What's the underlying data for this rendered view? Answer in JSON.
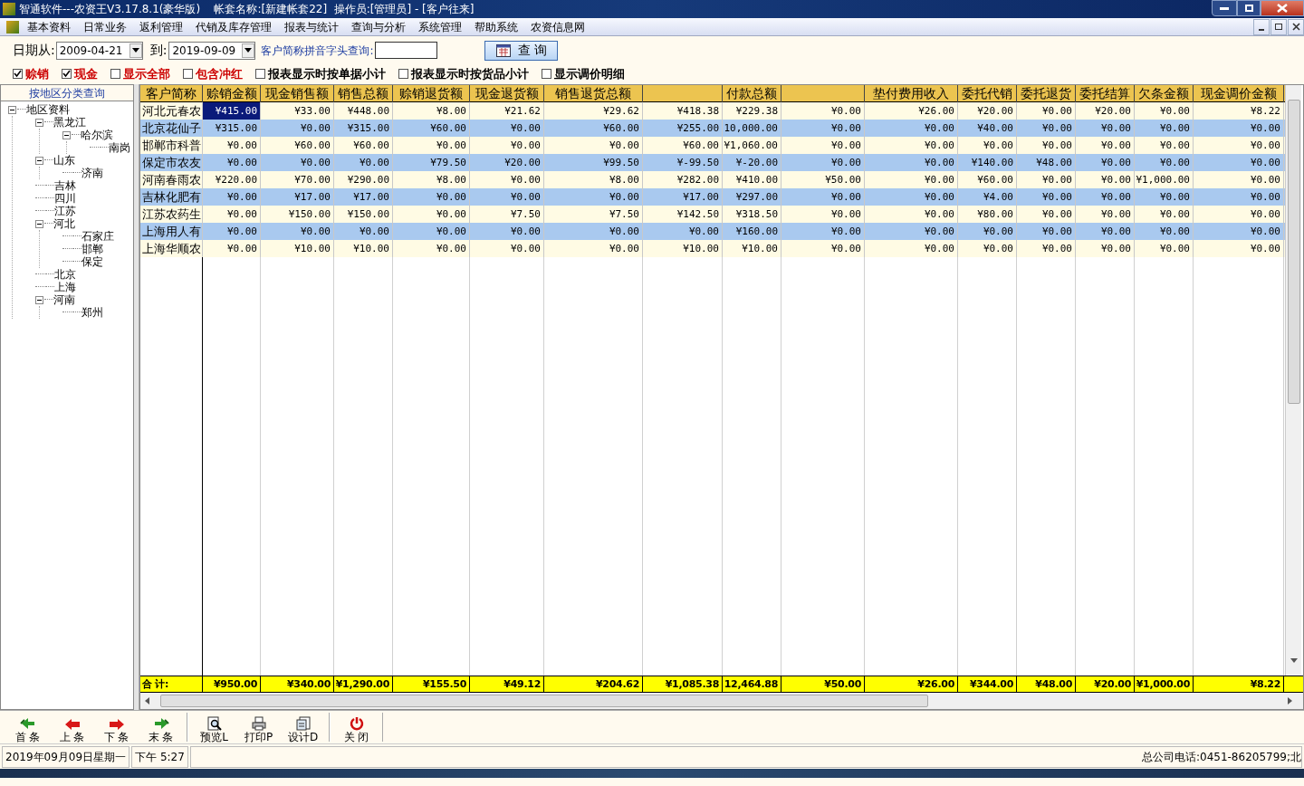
{
  "window": {
    "title": "智通软件---农资王V3.17.8.1(豪华版)    帐套名称:[新建帐套22]  操作员:[管理员] - [客户往来]"
  },
  "menu": [
    "基本资料",
    "日常业务",
    "返利管理",
    "代销及库存管理",
    "报表与统计",
    "查询与分析",
    "系统管理",
    "帮助系统",
    "农资信息网"
  ],
  "filters": {
    "date_from_label": "日期从:",
    "date_from": "2009-04-21",
    "date_to_label": "到:",
    "date_to": "2019-09-09",
    "pinyin_label": "客户简称拼音字头查询:",
    "query_button": "查 询"
  },
  "options": [
    {
      "label": "赊销",
      "checked": true,
      "color": "#cc0000"
    },
    {
      "label": "现金",
      "checked": true,
      "color": "#cc0000"
    },
    {
      "label": "显示全部",
      "checked": false,
      "color": "#cc0000"
    },
    {
      "label": "包含冲红",
      "checked": false,
      "color": "#cc0000"
    },
    {
      "label": "报表显示时按单据小计",
      "checked": false,
      "color": "#000000"
    },
    {
      "label": "报表显示时按货品小计",
      "checked": false,
      "color": "#000000"
    },
    {
      "label": "显示调价明细",
      "checked": false,
      "color": "#000000"
    }
  ],
  "sidebar": {
    "title": "按地区分类查询",
    "tree": [
      {
        "label": "地区资料",
        "expanded": true,
        "children": [
          {
            "label": "黑龙江",
            "expanded": true,
            "children": [
              {
                "label": "哈尔滨",
                "expanded": true,
                "children": [
                  {
                    "label": "南岗"
                  }
                ]
              }
            ]
          },
          {
            "label": "山东",
            "expanded": true,
            "children": [
              {
                "label": "济南"
              }
            ]
          },
          {
            "label": "吉林"
          },
          {
            "label": "四川"
          },
          {
            "label": "江苏"
          },
          {
            "label": "河北",
            "expanded": true,
            "children": [
              {
                "label": "石家庄"
              },
              {
                "label": "邯郸"
              },
              {
                "label": "保定"
              }
            ]
          },
          {
            "label": "北京"
          },
          {
            "label": "上海"
          },
          {
            "label": "河南",
            "expanded": true,
            "children": [
              {
                "label": "郑州"
              }
            ]
          }
        ]
      }
    ]
  },
  "table": {
    "columns": [
      {
        "header": "客户简称"
      },
      {
        "header": "赊销金额"
      },
      {
        "header": "现金销售额"
      },
      {
        "header": "销售总额"
      },
      {
        "header": "赊销退货额"
      },
      {
        "header": "现金退货额"
      },
      {
        "header": "销售退货总额"
      },
      {},
      {
        "header": "付款总额"
      },
      {},
      {
        "header": "垫付费用收入"
      },
      {
        "header": "委托代销"
      },
      {
        "header": "委托退货"
      },
      {
        "header": "委托结算"
      },
      {
        "header": "欠条金额"
      },
      {
        "header": "现金调价金额"
      }
    ],
    "rows": [
      {
        "selected": true,
        "cells": [
          "河北元春农",
          "¥415.00",
          "¥33.00",
          "¥448.00",
          "¥8.00",
          "¥21.62",
          "¥29.62",
          "¥418.38",
          "¥229.38",
          "¥0.00",
          "¥26.00",
          "¥20.00",
          "¥0.00",
          "¥20.00",
          "¥0.00",
          "¥8.22"
        ]
      },
      {
        "selected": false,
        "cells": [
          "北京花仙子",
          "¥315.00",
          "¥0.00",
          "¥315.00",
          "¥60.00",
          "¥0.00",
          "¥60.00",
          "¥255.00",
          "10,000.00",
          "¥0.00",
          "¥0.00",
          "¥40.00",
          "¥0.00",
          "¥0.00",
          "¥0.00",
          "¥0.00"
        ]
      },
      {
        "selected": false,
        "cells": [
          "邯郸市科普",
          "¥0.00",
          "¥60.00",
          "¥60.00",
          "¥0.00",
          "¥0.00",
          "¥0.00",
          "¥60.00",
          "¥1,060.00",
          "¥0.00",
          "¥0.00",
          "¥0.00",
          "¥0.00",
          "¥0.00",
          "¥0.00",
          "¥0.00"
        ]
      },
      {
        "selected": false,
        "cells": [
          "保定市农友",
          "¥0.00",
          "¥0.00",
          "¥0.00",
          "¥79.50",
          "¥20.00",
          "¥99.50",
          "¥-99.50",
          "¥-20.00",
          "¥0.00",
          "¥0.00",
          "¥140.00",
          "¥48.00",
          "¥0.00",
          "¥0.00",
          "¥0.00"
        ]
      },
      {
        "selected": false,
        "cells": [
          "河南春雨农",
          "¥220.00",
          "¥70.00",
          "¥290.00",
          "¥8.00",
          "¥0.00",
          "¥8.00",
          "¥282.00",
          "¥410.00",
          "¥50.00",
          "¥0.00",
          "¥60.00",
          "¥0.00",
          "¥0.00",
          "¥1,000.00",
          "¥0.00"
        ]
      },
      {
        "selected": false,
        "cells": [
          "吉林化肥有",
          "¥0.00",
          "¥17.00",
          "¥17.00",
          "¥0.00",
          "¥0.00",
          "¥0.00",
          "¥17.00",
          "¥297.00",
          "¥0.00",
          "¥0.00",
          "¥4.00",
          "¥0.00",
          "¥0.00",
          "¥0.00",
          "¥0.00"
        ]
      },
      {
        "selected": false,
        "cells": [
          "江苏农药生",
          "¥0.00",
          "¥150.00",
          "¥150.00",
          "¥0.00",
          "¥7.50",
          "¥7.50",
          "¥142.50",
          "¥318.50",
          "¥0.00",
          "¥0.00",
          "¥80.00",
          "¥0.00",
          "¥0.00",
          "¥0.00",
          "¥0.00"
        ]
      },
      {
        "selected": false,
        "cells": [
          "上海用人有",
          "¥0.00",
          "¥0.00",
          "¥0.00",
          "¥0.00",
          "¥0.00",
          "¥0.00",
          "¥0.00",
          "¥160.00",
          "¥0.00",
          "¥0.00",
          "¥0.00",
          "¥0.00",
          "¥0.00",
          "¥0.00",
          "¥0.00"
        ]
      },
      {
        "selected": false,
        "cells": [
          "上海华顺农",
          "¥0.00",
          "¥10.00",
          "¥10.00",
          "¥0.00",
          "¥0.00",
          "¥0.00",
          "¥10.00",
          "¥10.00",
          "¥0.00",
          "¥0.00",
          "¥0.00",
          "¥0.00",
          "¥0.00",
          "¥0.00",
          "¥0.00"
        ]
      }
    ],
    "totals": [
      "合 计:",
      "¥950.00",
      "¥340.00",
      "¥1,290.00",
      "¥155.50",
      "¥49.12",
      "¥204.62",
      "¥1,085.38",
      "12,464.88",
      "¥50.00",
      "¥26.00",
      "¥344.00",
      "¥48.00",
      "¥20.00",
      "¥1,000.00",
      "¥8.22"
    ]
  },
  "toolbar": [
    {
      "kind": "first",
      "label": "首 条"
    },
    {
      "kind": "prev",
      "label": "上 条"
    },
    {
      "kind": "next",
      "label": "下 条"
    },
    {
      "kind": "last",
      "label": "末 条"
    },
    {
      "kind": "preview",
      "label": "预览L"
    },
    {
      "kind": "print",
      "label": "打印P"
    },
    {
      "kind": "design",
      "label": "设计D"
    },
    {
      "kind": "close",
      "label": "关 闭"
    }
  ],
  "status_bar": {
    "date": "2019年09月09日星期一",
    "time": "下午 5:27",
    "phone": "总公司电话:0451-86205799;北"
  }
}
